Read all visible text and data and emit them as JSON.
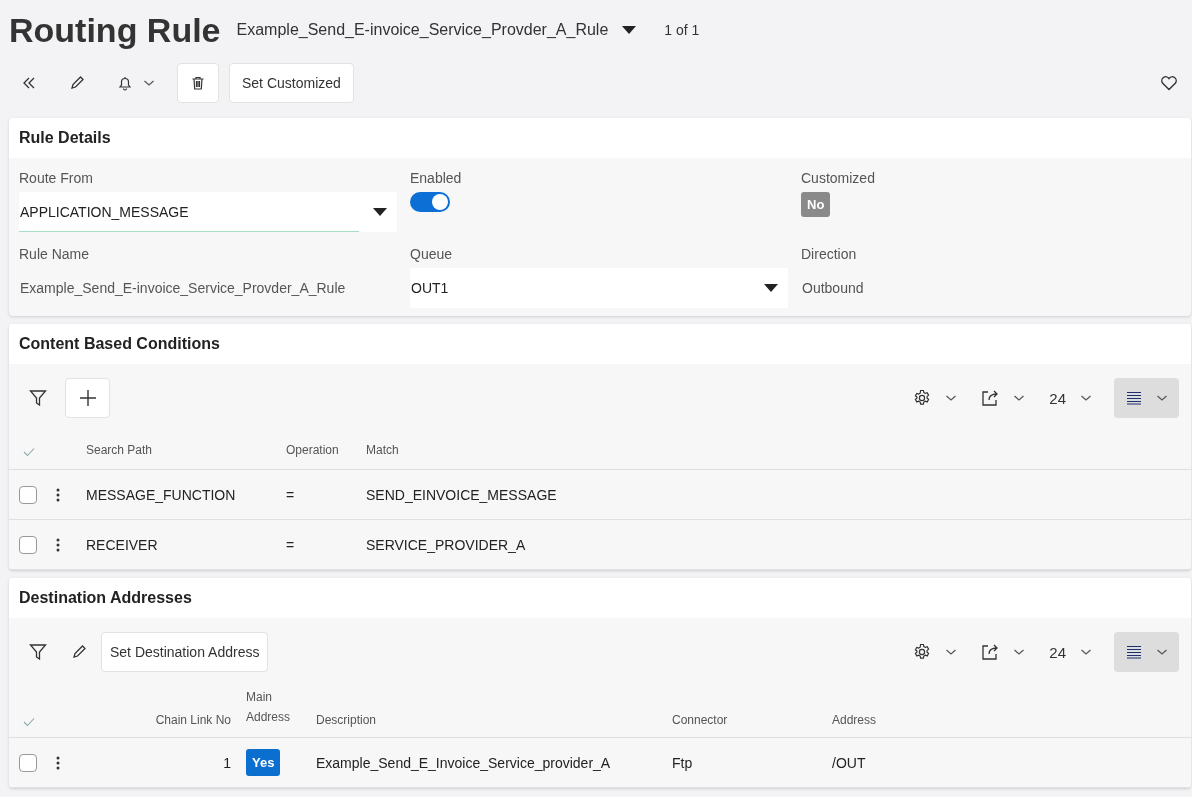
{
  "page": {
    "title": "Routing Rule",
    "record": "Example_Send_E-invoice_Service_Provder_A_Rule",
    "record_count": "1 of 1"
  },
  "toolbar": {
    "button": "Set Customized"
  },
  "rule_details": {
    "title": "Rule Details",
    "fields": [
      {
        "kind": "dropdown",
        "label": "Route From",
        "value": "APPLICATION_MESSAGE"
      },
      {
        "kind": "toggle",
        "label": "Enabled",
        "on": true
      },
      {
        "kind": "badge",
        "label": "Customized",
        "value": "No"
      },
      {
        "kind": "readonly",
        "label": "Rule Name",
        "value": "Example_Send_E-invoice_Service_Provder_A_Rule"
      },
      {
        "kind": "dropdown",
        "label": "Queue",
        "value": "OUT1"
      },
      {
        "kind": "readonly",
        "label": "Direction",
        "value": "Outbound"
      }
    ]
  },
  "content_conditions": {
    "title": "Content Based Conditions",
    "page_size": "24",
    "columns": [
      {
        "label": "Search Path",
        "kind": "text"
      },
      {
        "label": "Operation",
        "kind": "text"
      },
      {
        "label": "Match",
        "kind": "text"
      }
    ],
    "rows": [
      {
        "selected": false,
        "cells": [
          "MESSAGE_FUNCTION",
          "=",
          "SEND_EINVOICE_MESSAGE"
        ]
      },
      {
        "selected": false,
        "cells": [
          "RECEIVER",
          "=",
          "SERVICE_PROVIDER_A"
        ]
      }
    ]
  },
  "destination_addresses": {
    "title": "Destination Addresses",
    "action": "Set Destination Address",
    "page_size": "24",
    "columns": [
      {
        "label": "Chain Link No",
        "kind": "number"
      },
      {
        "label": "Main Address",
        "kind": "badge"
      },
      {
        "label": "Description",
        "kind": "text"
      },
      {
        "label": "Connector",
        "kind": "text"
      },
      {
        "label": "Address",
        "kind": "text"
      }
    ],
    "rows": [
      {
        "selected": false,
        "cells": [
          "1",
          "Yes",
          "Example_Send_E_Invoice_Service_provider_A",
          "Ftp",
          "/OUT"
        ]
      }
    ]
  }
}
